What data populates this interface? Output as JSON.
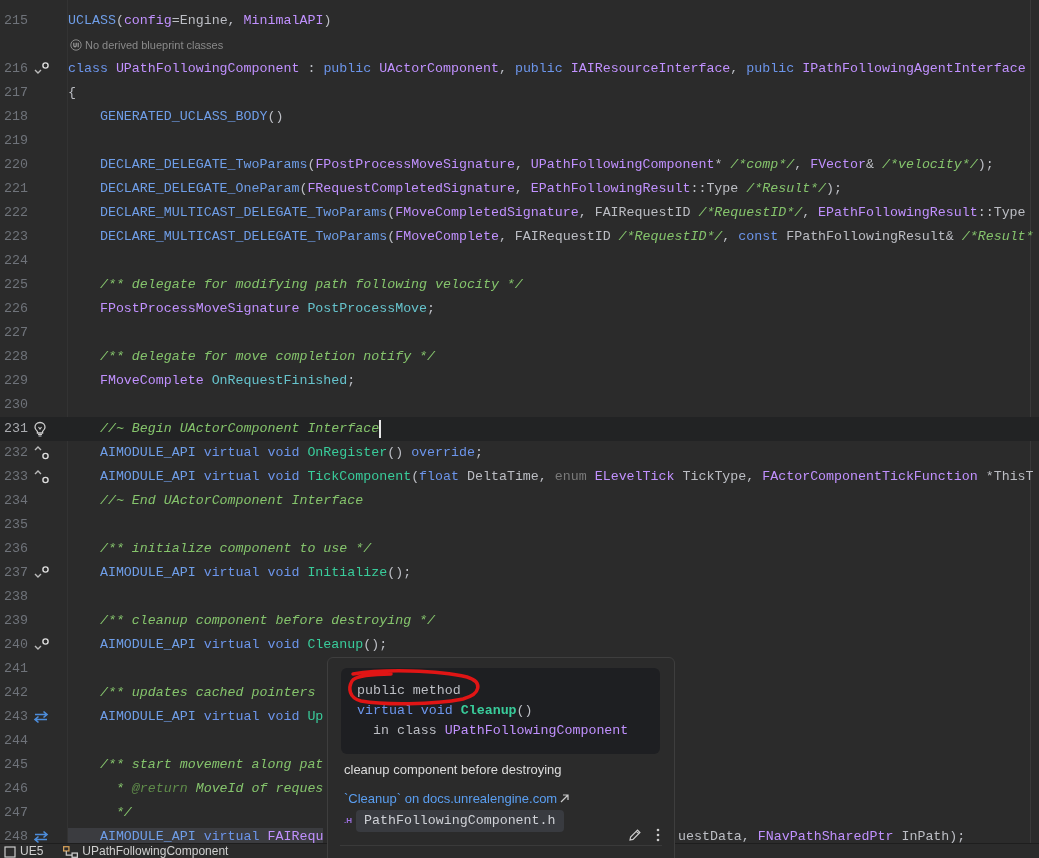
{
  "editor": {
    "lines": [
      {
        "number": "215",
        "tokens": [
          {
            "kind": "macro",
            "text": "UCLASS"
          },
          {
            "kind": "plain",
            "text": "("
          },
          {
            "kind": "type",
            "text": "config"
          },
          {
            "kind": "plain",
            "text": "=Engine, "
          },
          {
            "kind": "type",
            "text": "MinimalAPI"
          },
          {
            "kind": "plain",
            "text": ")"
          }
        ]
      },
      {
        "kind": "hint",
        "text": "No derived blueprint classes"
      },
      {
        "number": "216",
        "marker": {
          "kind": "implemented"
        },
        "tokens": [
          {
            "kind": "keyword",
            "text": "class "
          },
          {
            "kind": "type",
            "text": "UPathFollowingComponent"
          },
          {
            "kind": "plain",
            "text": " : "
          },
          {
            "kind": "keyword",
            "text": "public "
          },
          {
            "kind": "type",
            "text": "UActorComponent"
          },
          {
            "kind": "plain",
            "text": ", "
          },
          {
            "kind": "keyword",
            "text": "public "
          },
          {
            "kind": "type",
            "text": "IAIResourceInterface"
          },
          {
            "kind": "plain",
            "text": ", "
          },
          {
            "kind": "keyword",
            "text": "public "
          },
          {
            "kind": "type",
            "text": "IPathFollowingAgentInterface"
          }
        ]
      },
      {
        "number": "217",
        "tokens": [
          {
            "kind": "plain",
            "text": "{"
          }
        ]
      },
      {
        "number": "218",
        "tokens": [
          {
            "kind": "macro",
            "text": "    GENERATED_UCLASS_BODY"
          },
          {
            "kind": "plain",
            "text": "()"
          }
        ]
      },
      {
        "number": "219"
      },
      {
        "number": "220",
        "tokens": [
          {
            "kind": "macro",
            "text": "    DECLARE_DELEGATE_TwoParams"
          },
          {
            "kind": "plain",
            "text": "("
          },
          {
            "kind": "type",
            "text": "FPostProcessMoveSignature"
          },
          {
            "kind": "plain",
            "text": ", "
          },
          {
            "kind": "type",
            "text": "UPathFollowingComponent"
          },
          {
            "kind": "plain",
            "text": "* "
          },
          {
            "kind": "comment",
            "text": "/*comp*/"
          },
          {
            "kind": "plain",
            "text": ", "
          },
          {
            "kind": "type",
            "text": "FVector"
          },
          {
            "kind": "plain",
            "text": "& "
          },
          {
            "kind": "comment",
            "text": "/*velocity*/"
          },
          {
            "kind": "plain",
            "text": ");"
          }
        ]
      },
      {
        "number": "221",
        "tokens": [
          {
            "kind": "macro",
            "text": "    DECLARE_DELEGATE_OneParam"
          },
          {
            "kind": "plain",
            "text": "("
          },
          {
            "kind": "type",
            "text": "FRequestCompletedSignature"
          },
          {
            "kind": "plain",
            "text": ", "
          },
          {
            "kind": "type",
            "text": "EPathFollowingResult"
          },
          {
            "kind": "plain",
            "text": "::Type "
          },
          {
            "kind": "comment",
            "text": "/*Result*/"
          },
          {
            "kind": "plain",
            "text": ");"
          }
        ]
      },
      {
        "number": "222",
        "tokens": [
          {
            "kind": "macro",
            "text": "    DECLARE_MULTICAST_DELEGATE_TwoParams"
          },
          {
            "kind": "plain",
            "text": "("
          },
          {
            "kind": "type",
            "text": "FMoveCompletedSignature"
          },
          {
            "kind": "plain",
            "text": ", FAIRequestID "
          },
          {
            "kind": "comment",
            "text": "/*RequestID*/"
          },
          {
            "kind": "plain",
            "text": ", "
          },
          {
            "kind": "type",
            "text": "EPathFollowingResult"
          },
          {
            "kind": "plain",
            "text": "::Type"
          }
        ]
      },
      {
        "number": "223",
        "tokens": [
          {
            "kind": "macro",
            "text": "    DECLARE_MULTICAST_DELEGATE_TwoParams"
          },
          {
            "kind": "plain",
            "text": "("
          },
          {
            "kind": "type",
            "text": "FMoveComplete"
          },
          {
            "kind": "plain",
            "text": ", FAIRequestID "
          },
          {
            "kind": "comment",
            "text": "/*RequestID*/"
          },
          {
            "kind": "plain",
            "text": ", "
          },
          {
            "kind": "keyword",
            "text": "const "
          },
          {
            "kind": "plain",
            "text": "FPathFollowingResult& "
          },
          {
            "kind": "comment",
            "text": "/*Result*"
          }
        ]
      },
      {
        "number": "224"
      },
      {
        "number": "225",
        "tokens": [
          {
            "kind": "comment",
            "text": "    /** delegate for modifying path following velocity */"
          }
        ]
      },
      {
        "number": "226",
        "tokens": [
          {
            "kind": "type",
            "text": "    FPostProcessMoveSignature "
          },
          {
            "kind": "field",
            "text": "PostProcessMove"
          },
          {
            "kind": "plain",
            "text": ";"
          }
        ]
      },
      {
        "number": "227"
      },
      {
        "number": "228",
        "tokens": [
          {
            "kind": "comment",
            "text": "    /** delegate for move completion notify */"
          }
        ]
      },
      {
        "number": "229",
        "tokens": [
          {
            "kind": "type",
            "text": "    FMoveComplete "
          },
          {
            "kind": "field",
            "text": "OnRequestFinished"
          },
          {
            "kind": "plain",
            "text": ";"
          }
        ]
      },
      {
        "number": "230"
      },
      {
        "number": "231",
        "marker": {
          "kind": "bulb"
        },
        "current": true,
        "caret": true,
        "tokens": [
          {
            "kind": "comment",
            "text": "    //~ Begin UActorComponent Interface"
          }
        ]
      },
      {
        "number": "232",
        "marker": {
          "kind": "overrides"
        },
        "tokens": [
          {
            "kind": "macro",
            "text": "    AIMODULE_API "
          },
          {
            "kind": "keyword",
            "text": "virtual void "
          },
          {
            "kind": "function",
            "text": "OnRegister"
          },
          {
            "kind": "plain",
            "text": "() "
          },
          {
            "kind": "keyword",
            "text": "override"
          },
          {
            "kind": "plain",
            "text": ";"
          }
        ]
      },
      {
        "number": "233",
        "marker": {
          "kind": "overrides"
        },
        "tokens": [
          {
            "kind": "macro",
            "text": "    AIMODULE_API "
          },
          {
            "kind": "keyword",
            "text": "virtual void "
          },
          {
            "kind": "function",
            "text": "TickComponent"
          },
          {
            "kind": "plain",
            "text": "("
          },
          {
            "kind": "keyword",
            "text": "float "
          },
          {
            "kind": "plain",
            "text": "DeltaTime, "
          },
          {
            "kind": "muted",
            "text": "enum "
          },
          {
            "kind": "type",
            "text": "ELevelTick "
          },
          {
            "kind": "plain",
            "text": "TickType, "
          },
          {
            "kind": "type",
            "text": "FActorComponentTickFunction "
          },
          {
            "kind": "plain",
            "text": "*ThisT"
          }
        ]
      },
      {
        "number": "234",
        "tokens": [
          {
            "kind": "comment",
            "text": "    //~ End UActorComponent Interface"
          }
        ]
      },
      {
        "number": "235"
      },
      {
        "number": "236",
        "tokens": [
          {
            "kind": "comment",
            "text": "    /** initialize component to use */"
          }
        ]
      },
      {
        "number": "237",
        "marker": {
          "kind": "implemented"
        },
        "tokens": [
          {
            "kind": "macro",
            "text": "    AIMODULE_API "
          },
          {
            "kind": "keyword",
            "text": "virtual void "
          },
          {
            "kind": "function",
            "text": "Initialize"
          },
          {
            "kind": "plain",
            "text": "();"
          }
        ]
      },
      {
        "number": "238"
      },
      {
        "number": "239",
        "tokens": [
          {
            "kind": "comment",
            "text": "    /** cleanup component before destroying */"
          }
        ]
      },
      {
        "number": "240",
        "marker": {
          "kind": "implemented"
        },
        "tokens": [
          {
            "kind": "macro",
            "text": "    AIMODULE_API "
          },
          {
            "kind": "keyword",
            "text": "virtual void "
          },
          {
            "kind": "function",
            "text": "Cleanup"
          },
          {
            "kind": "plain",
            "text": "();"
          }
        ]
      },
      {
        "number": "241"
      },
      {
        "number": "242",
        "tokens": [
          {
            "kind": "comment",
            "text": "    /** updates cached pointers"
          }
        ]
      },
      {
        "number": "243",
        "marker": {
          "kind": "related"
        },
        "tokens": [
          {
            "kind": "macro",
            "text": "    AIMODULE_API "
          },
          {
            "kind": "keyword",
            "text": "virtual void "
          },
          {
            "kind": "function",
            "text": "Up"
          }
        ]
      },
      {
        "number": "244"
      },
      {
        "number": "245",
        "tokens": [
          {
            "kind": "comment",
            "text": "    /** start movement along pat"
          }
        ]
      },
      {
        "number": "246",
        "tokens": [
          {
            "kind": "comment",
            "text": "      * "
          },
          {
            "kind": "doc_tag",
            "text": "@return"
          },
          {
            "kind": "comment",
            "text": " MoveId of reques"
          }
        ]
      },
      {
        "number": "247",
        "tokens": [
          {
            "kind": "comment",
            "text": "      */"
          }
        ]
      },
      {
        "number": "248",
        "marker": {
          "kind": "related"
        },
        "highlighted": true,
        "tokens": [
          {
            "kind": "macro",
            "text": "    AIMODULE_API "
          },
          {
            "kind": "keyword",
            "text": "virtual "
          },
          {
            "kind": "type",
            "text": "FAIRequ"
          }
        ],
        "tail": [
          {
            "kind": "plain",
            "text": "uestData, "
          },
          {
            "kind": "type",
            "text": "FNavPathSharedPtr "
          },
          {
            "kind": "plain",
            "text": "InPath);"
          }
        ]
      }
    ]
  },
  "popup": {
    "signature": [
      {
        "tokens": [
          {
            "kind": "plain",
            "text": "public method"
          }
        ]
      },
      {
        "tokens": [
          {
            "kind": "keyword",
            "text": "virtual void "
          },
          {
            "kind": "function",
            "text": "Cleanup"
          },
          {
            "kind": "plain",
            "text": "()"
          }
        ]
      },
      {
        "tokens": [
          {
            "kind": "plain",
            "text": "  in class "
          },
          {
            "kind": "type",
            "text": "UPathFollowingComponent"
          }
        ]
      }
    ],
    "description": "cleanup component before destroying",
    "link": {
      "text": "`Cleanup` on docs.unrealengine.com"
    },
    "file": {
      "ext": ".H",
      "name": "PathFollowingComponent.h"
    }
  },
  "status_bar": {
    "items": [
      {
        "kind": "project",
        "text": "UE5"
      },
      {
        "kind": "class",
        "text": "UPathFollowingComponent"
      }
    ]
  }
}
